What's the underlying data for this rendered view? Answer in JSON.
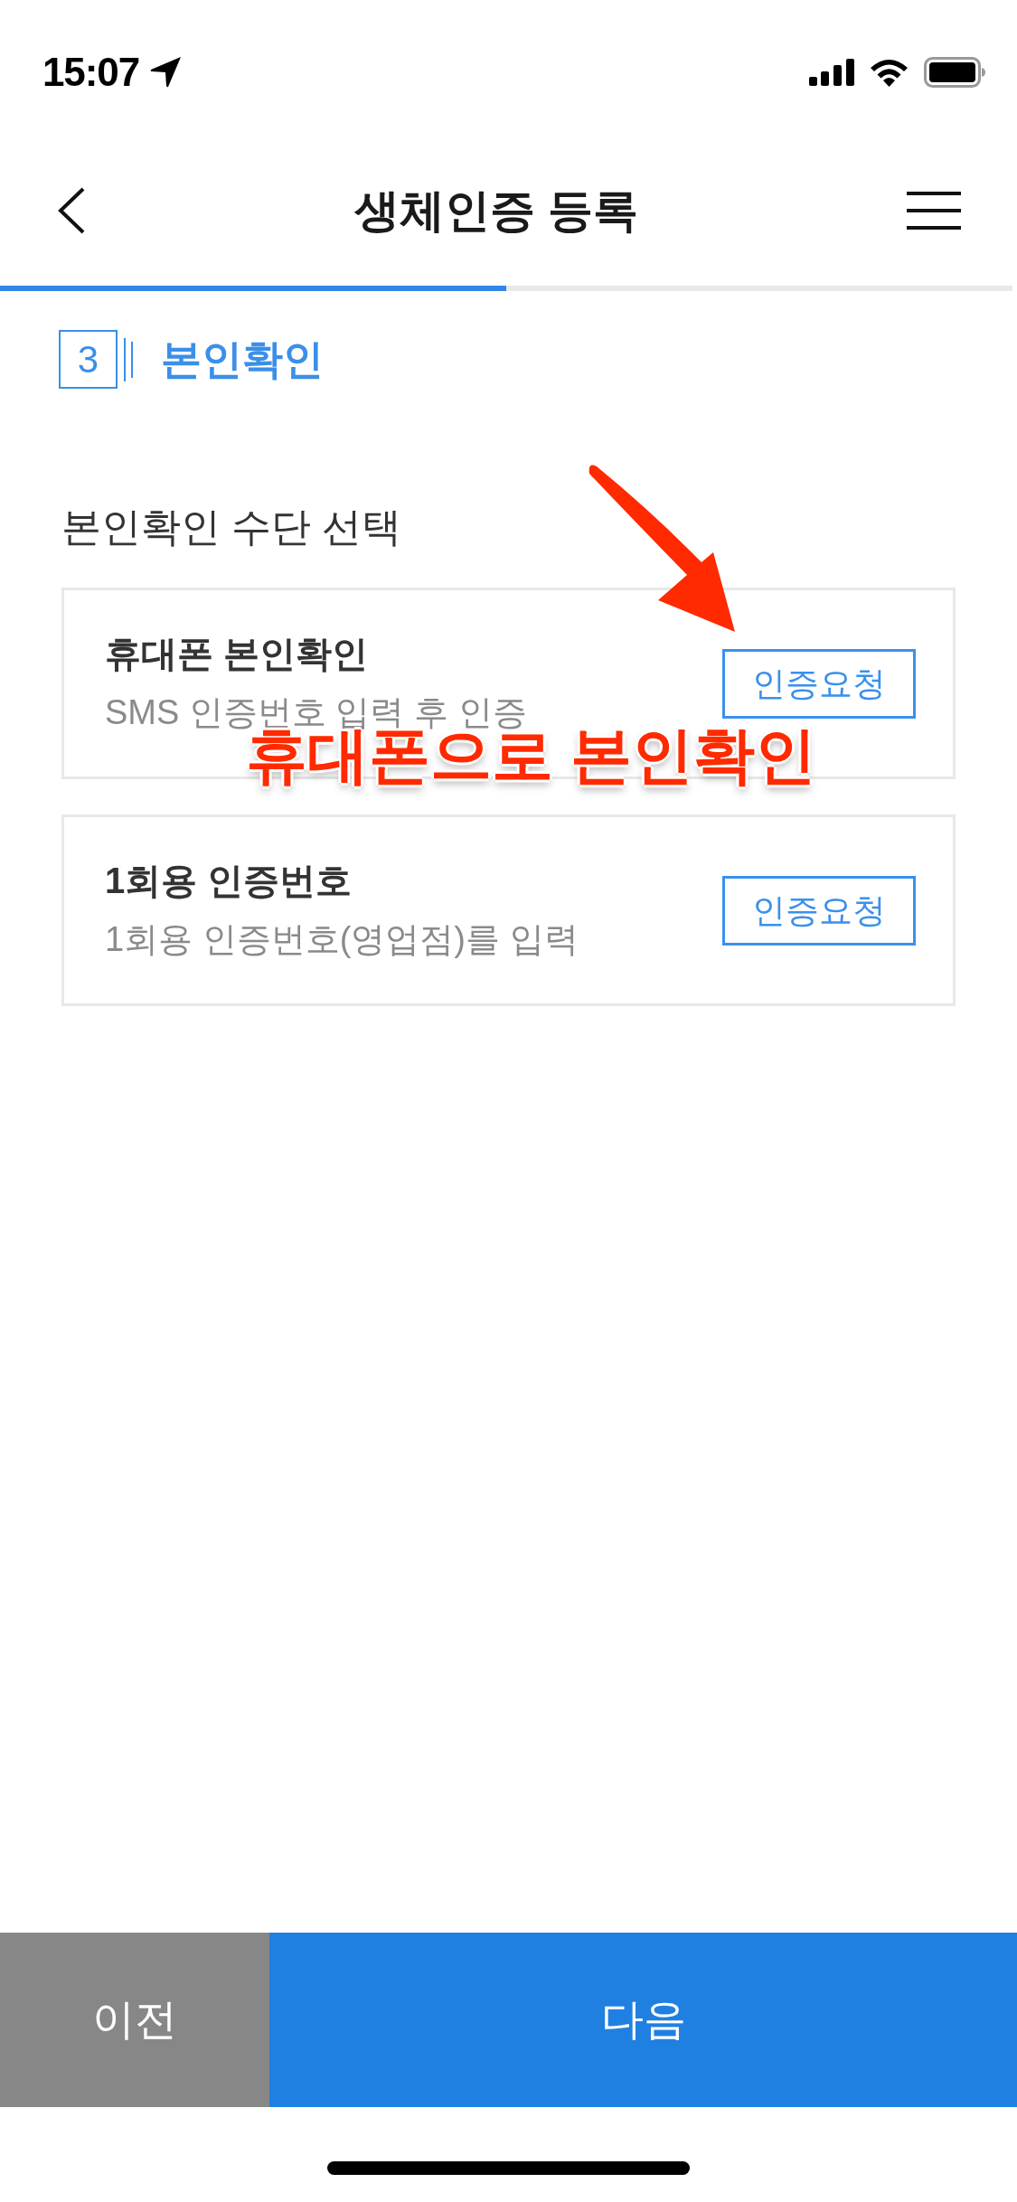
{
  "status_bar": {
    "time": "15:07"
  },
  "header": {
    "title": "생체인증 등록"
  },
  "progress": {
    "level": 0.5
  },
  "step": {
    "number": "3",
    "title": "본인확인"
  },
  "section_title": "본인확인 수단 선택",
  "methods": [
    {
      "title": "휴대폰 본인확인",
      "description": "SMS 인증번호 입력 후 인증",
      "button": "인증요청"
    },
    {
      "title": "1회용 인증번호",
      "description": "1회용 인증번호(영업점)를 입력",
      "button": "인증요청"
    }
  ],
  "annotation": {
    "text": "휴대폰으로 본인확인"
  },
  "footer_buttons": [
    {
      "label": "이전",
      "kind": "secondary"
    },
    {
      "label": "다음",
      "kind": "primary"
    }
  ]
}
